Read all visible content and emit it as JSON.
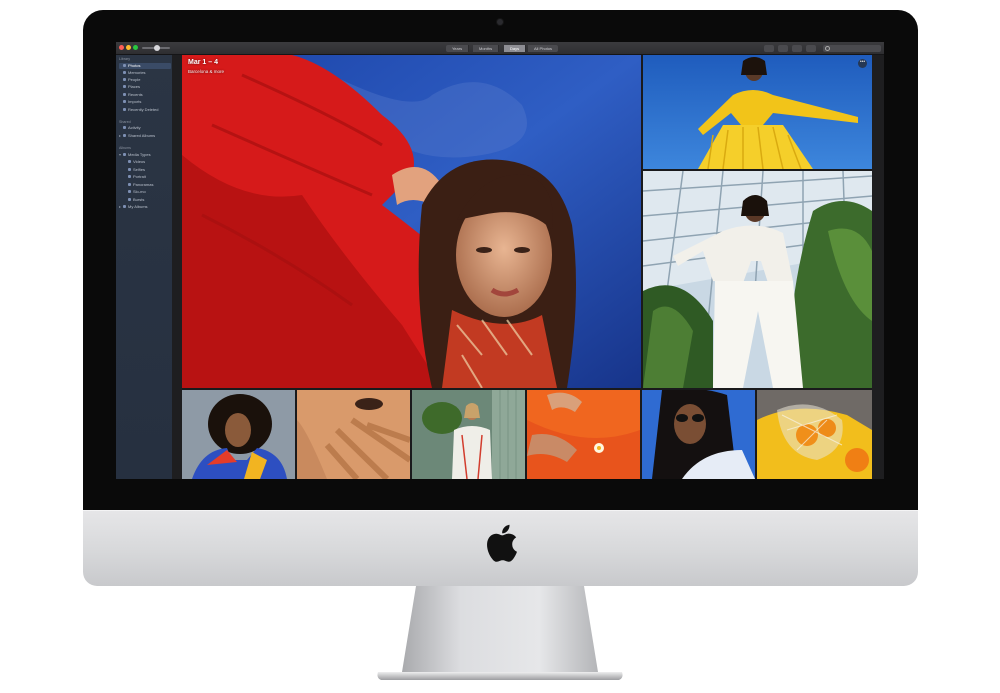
{
  "app": {
    "name": "Photos",
    "window": {
      "traffic_colors": [
        "#ff5f57",
        "#febc2e",
        "#28c840"
      ]
    }
  },
  "toolbar": {
    "zoom_level": 0.55,
    "view_tabs": [
      {
        "label": "Years",
        "active": false
      },
      {
        "label": "Months",
        "active": false
      },
      {
        "label": "Days",
        "active": true
      },
      {
        "label": "All Photos",
        "active": false
      }
    ],
    "buttons": [
      "info-icon",
      "share-icon",
      "heart-icon",
      "rotate-icon"
    ],
    "search_placeholder": ""
  },
  "sidebar": {
    "library_heading": "Library",
    "library_items": [
      {
        "label": "Photos",
        "icon": "photos-icon",
        "selected": true
      },
      {
        "label": "Memories",
        "icon": "memories-icon",
        "selected": false
      },
      {
        "label": "People",
        "icon": "people-icon",
        "selected": false
      },
      {
        "label": "Places",
        "icon": "places-icon",
        "selected": false
      },
      {
        "label": "Recents",
        "icon": "recents-icon",
        "selected": false
      },
      {
        "label": "Imports",
        "icon": "imports-icon",
        "selected": false
      },
      {
        "label": "Recently Deleted",
        "icon": "trash-icon",
        "selected": false
      }
    ],
    "shared_heading": "Shared",
    "shared_items": [
      {
        "label": "Activity",
        "icon": "activity-icon"
      },
      {
        "label": "Shared Albums",
        "icon": "shared-albums-icon"
      }
    ],
    "albums_heading": "Albums",
    "albums_items": [
      {
        "label": "Media Types",
        "icon": "media-types-icon",
        "expandable": true
      },
      {
        "label": "Videos",
        "icon": "videos-icon",
        "indent": true
      },
      {
        "label": "Selfies",
        "icon": "selfies-icon",
        "indent": true
      },
      {
        "label": "Portrait",
        "icon": "portrait-icon",
        "indent": true
      },
      {
        "label": "Panoramas",
        "icon": "panoramas-icon",
        "indent": true
      },
      {
        "label": "Slo-mo",
        "icon": "slomo-icon",
        "indent": true
      },
      {
        "label": "Bursts",
        "icon": "bursts-icon",
        "indent": true
      },
      {
        "label": "My Albums",
        "icon": "my-albums-icon",
        "expandable": true
      }
    ]
  },
  "day_header": {
    "date": "Mar 1 – 4",
    "location": "Barcelona & more"
  },
  "hardware": {
    "bezel_color": "#0a0a0a",
    "chin_color": "#d7d8da",
    "stand_color": "#c9cacd"
  }
}
